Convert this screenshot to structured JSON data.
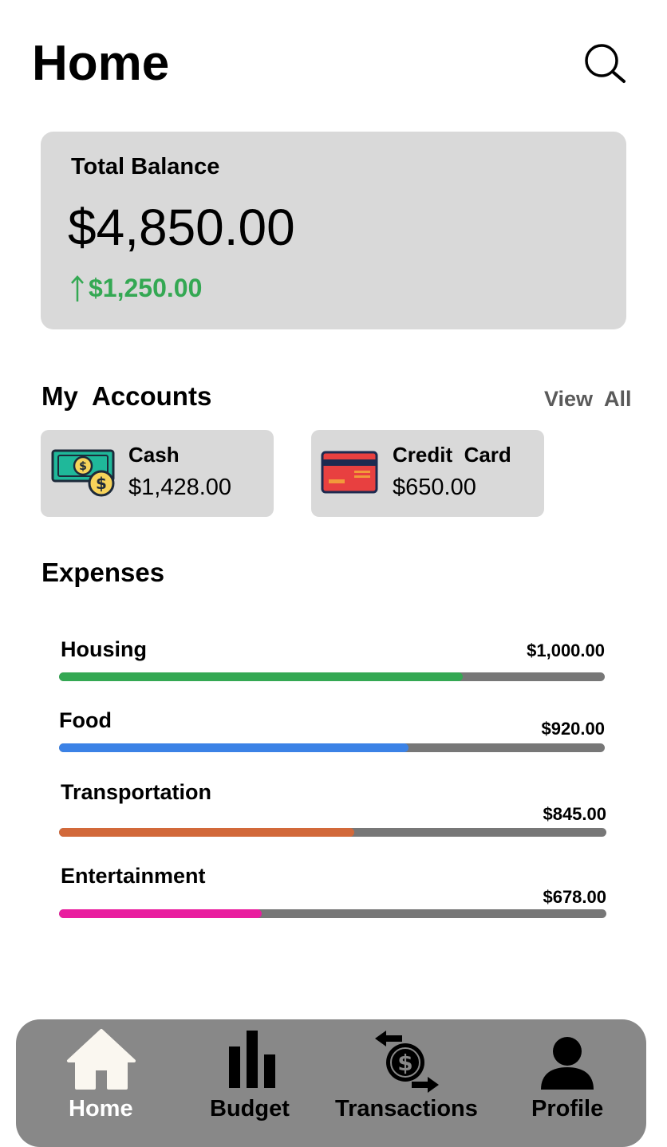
{
  "header": {
    "title": "Home"
  },
  "balance": {
    "label": "Total Balance",
    "amount": "$4,850.00",
    "change": "$1,250.00"
  },
  "accounts": {
    "title": "My  Accounts",
    "view_all": "View  All",
    "items": [
      {
        "name": "Cash",
        "amount": "$1,428.00",
        "icon": "cash-icon"
      },
      {
        "name": "Credit  Card",
        "amount": "$650.00",
        "icon": "credit-card-icon"
      }
    ]
  },
  "expenses": {
    "title": "Expenses",
    "items": [
      {
        "label": "Housing",
        "amount": "$1,000.00",
        "progress": 0.74,
        "color": "#34a853"
      },
      {
        "label": "Food",
        "amount": "$920.00",
        "progress": 0.64,
        "color": "#3b82e6"
      },
      {
        "label": "Transportation",
        "amount": "$845.00",
        "progress": 0.54,
        "color": "#d2693a"
      },
      {
        "label": "Entertainment",
        "amount": "$678.00",
        "progress": 0.37,
        "color": "#e91e9f"
      }
    ]
  },
  "nav": {
    "items": [
      {
        "label": "Home",
        "icon": "home-icon",
        "active": true
      },
      {
        "label": "Budget",
        "icon": "bar-chart-icon",
        "active": false
      },
      {
        "label": "Transactions",
        "icon": "transactions-icon",
        "active": false
      },
      {
        "label": "Profile",
        "icon": "person-icon",
        "active": false
      }
    ]
  },
  "colors": {
    "positive": "#34a853",
    "card_bg": "#d9d9d9",
    "nav_bg": "#888888",
    "track": "#777777"
  }
}
